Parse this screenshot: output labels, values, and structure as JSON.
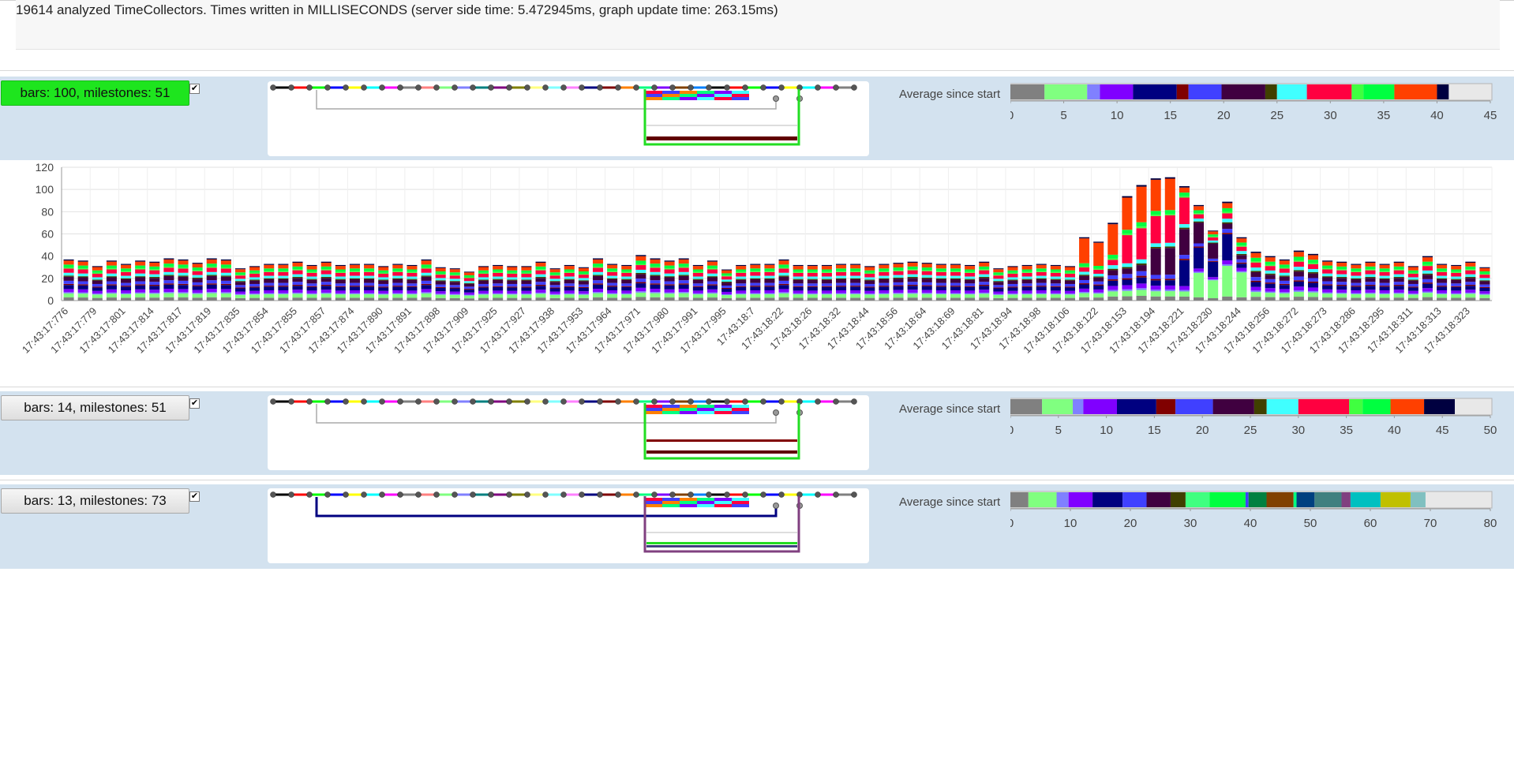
{
  "status": {
    "text": "19614 analyzed TimeCollectors. Times written in MILLISECONDS (server side time: 5.472945ms, graph update time: 263.15ms)"
  },
  "sections": [
    {
      "button_label": "bars: 100, milestones: 51",
      "checked": true,
      "average_label": "Average since start",
      "avg_ticks": [
        "0",
        "5",
        "10",
        "15",
        "20",
        "25",
        "30",
        "35",
        "40",
        "45"
      ],
      "avg_max": 45,
      "avg_segments": [
        {
          "color": "#808080",
          "value": 3.2
        },
        {
          "color": "#80ff80",
          "value": 4
        },
        {
          "color": "#8080ff",
          "value": 1.2
        },
        {
          "color": "#8000ff",
          "value": 3.1
        },
        {
          "color": "#000080",
          "value": 4.1
        },
        {
          "color": "#800000",
          "value": 1.1
        },
        {
          "color": "#4040ff",
          "value": 3.1
        },
        {
          "color": "#400040",
          "value": 4.1
        },
        {
          "color": "#404000",
          "value": 1.1
        },
        {
          "color": "#40ffff",
          "value": 2.8
        },
        {
          "color": "#ff0040",
          "value": 4.2
        },
        {
          "color": "#40ff40",
          "value": 1.1
        },
        {
          "color": "#00ff40",
          "value": 2.9
        },
        {
          "color": "#ff4000",
          "value": 4
        },
        {
          "color": "#000040",
          "value": 1.1
        }
      ]
    },
    {
      "button_label": "bars: 14, milestones: 51",
      "checked": true,
      "average_label": "Average since start",
      "avg_ticks": [
        "0",
        "5",
        "10",
        "15",
        "20",
        "25",
        "30",
        "35",
        "40",
        "45",
        "50"
      ],
      "avg_max": 50,
      "avg_segments": [
        {
          "color": "#808080",
          "value": 3.3
        },
        {
          "color": "#80ff80",
          "value": 3.2
        },
        {
          "color": "#8080ff",
          "value": 1.1
        },
        {
          "color": "#8000ff",
          "value": 3.5
        },
        {
          "color": "#000080",
          "value": 4.1
        },
        {
          "color": "#800000",
          "value": 2
        },
        {
          "color": "#4040ff",
          "value": 3.9
        },
        {
          "color": "#400040",
          "value": 4.3
        },
        {
          "color": "#404000",
          "value": 1.3
        },
        {
          "color": "#40ffff",
          "value": 3.3
        },
        {
          "color": "#ff0040",
          "value": 5.3
        },
        {
          "color": "#40ff40",
          "value": 1.4
        },
        {
          "color": "#00ff40",
          "value": 2.9
        },
        {
          "color": "#ff4000",
          "value": 3.5
        },
        {
          "color": "#000040",
          "value": 3.2
        }
      ]
    },
    {
      "button_label": "bars: 13, milestones: 73",
      "checked": true,
      "average_label": "Average since start",
      "avg_ticks": [
        "0",
        "10",
        "20",
        "30",
        "40",
        "50",
        "60",
        "70",
        "80"
      ],
      "avg_max": 80,
      "avg_segments": [
        {
          "color": "#808080",
          "value": 3
        },
        {
          "color": "#80ff80",
          "value": 4.7
        },
        {
          "color": "#8080ff",
          "value": 2
        },
        {
          "color": "#8000ff",
          "value": 4
        },
        {
          "color": "#000080",
          "value": 5
        },
        {
          "color": "#4040ff",
          "value": 4
        },
        {
          "color": "#400040",
          "value": 4
        },
        {
          "color": "#404000",
          "value": 2.5
        },
        {
          "color": "#40ff80",
          "value": 4
        },
        {
          "color": "#00ff40",
          "value": 6
        },
        {
          "color": "#4040ff",
          "value": 0.5
        },
        {
          "color": "#008040",
          "value": 3
        },
        {
          "color": "#804000",
          "value": 4.5
        },
        {
          "color": "#00ff80",
          "value": 0.5
        },
        {
          "color": "#004080",
          "value": 3
        },
        {
          "color": "#408080",
          "value": 4.5
        },
        {
          "color": "#804080",
          "value": 1.5
        },
        {
          "color": "#00c0c0",
          "value": 5
        },
        {
          "color": "#c0c000",
          "value": 5
        },
        {
          "color": "#80c0c0",
          "value": 2.5
        }
      ]
    }
  ],
  "chart_data": {
    "type": "bar",
    "stacked": true,
    "ylim": [
      0,
      120
    ],
    "yticks": [
      0,
      20,
      40,
      60,
      80,
      100,
      120
    ],
    "grid": true,
    "xlabels": [
      "17:43:17:776",
      "17:43:17:779",
      "17:43:17:801",
      "17:43:17:814",
      "17:43:17:817",
      "17:43:17:819",
      "17:43:17:835",
      "17:43:17:854",
      "17:43:17:855",
      "17:43:17:857",
      "17:43:17:874",
      "17:43:17:890",
      "17:43:17:891",
      "17:43:17:898",
      "17:43:17:909",
      "17:43:17:925",
      "17:43:17:927",
      "17:43:17:938",
      "17:43:17:953",
      "17:43:17:964",
      "17:43:17:971",
      "17:43:17:980",
      "17:43:17:991",
      "17:43:17:995",
      "17:43:18:7",
      "17:43:18:22",
      "17:43:18:26",
      "17:43:18:32",
      "17:43:18:44",
      "17:43:18:56",
      "17:43:18:64",
      "17:43:18:69",
      "17:43:18:81",
      "17:43:18:94",
      "17:43:18:98",
      "17:43:18:106",
      "17:43:18:122",
      "17:43:18:153",
      "17:43:18:194",
      "17:43:18:221",
      "17:43:18:230",
      "17:43:18:244",
      "17:43:18:256",
      "17:43:18:272",
      "17:43:18:273",
      "17:43:18:286",
      "17:43:18:295",
      "17:43:18:311",
      "17:43:18:313",
      "17:43:18:323"
    ],
    "totals": [
      37,
      36,
      31,
      36,
      33,
      36,
      35,
      38,
      37,
      34,
      38,
      37,
      29,
      31,
      33,
      33,
      35,
      32,
      35,
      32,
      33,
      33,
      31,
      33,
      32,
      37,
      30,
      29,
      26,
      31,
      32,
      31,
      31,
      35,
      29,
      32,
      30,
      38,
      33,
      32,
      41,
      38,
      36,
      38,
      32,
      36,
      28,
      32,
      33,
      33,
      37,
      32,
      32,
      32,
      33,
      33,
      31,
      33,
      34,
      35,
      34,
      33,
      33,
      32,
      35,
      29,
      31,
      32,
      33,
      32,
      31,
      57,
      53,
      70,
      94,
      104,
      110,
      111,
      103,
      86,
      63,
      89,
      57,
      44,
      40,
      37,
      45,
      42,
      36,
      35,
      33,
      35,
      33,
      35,
      31,
      40,
      33,
      32,
      35,
      30
    ],
    "series_colors": [
      "#808080",
      "#80ff80",
      "#8080ff",
      "#8000ff",
      "#000080",
      "#800000",
      "#4040ff",
      "#400040",
      "#404000",
      "#40ffff",
      "#ff0040",
      "#40ff40",
      "#00ff40",
      "#ff4000",
      "#000040"
    ],
    "series_weights": [
      3.2,
      4,
      1.2,
      3.1,
      4.1,
      1.1,
      3.1,
      4.1,
      1.1,
      2.8,
      4.2,
      1.1,
      2.9,
      4,
      1.1
    ]
  }
}
